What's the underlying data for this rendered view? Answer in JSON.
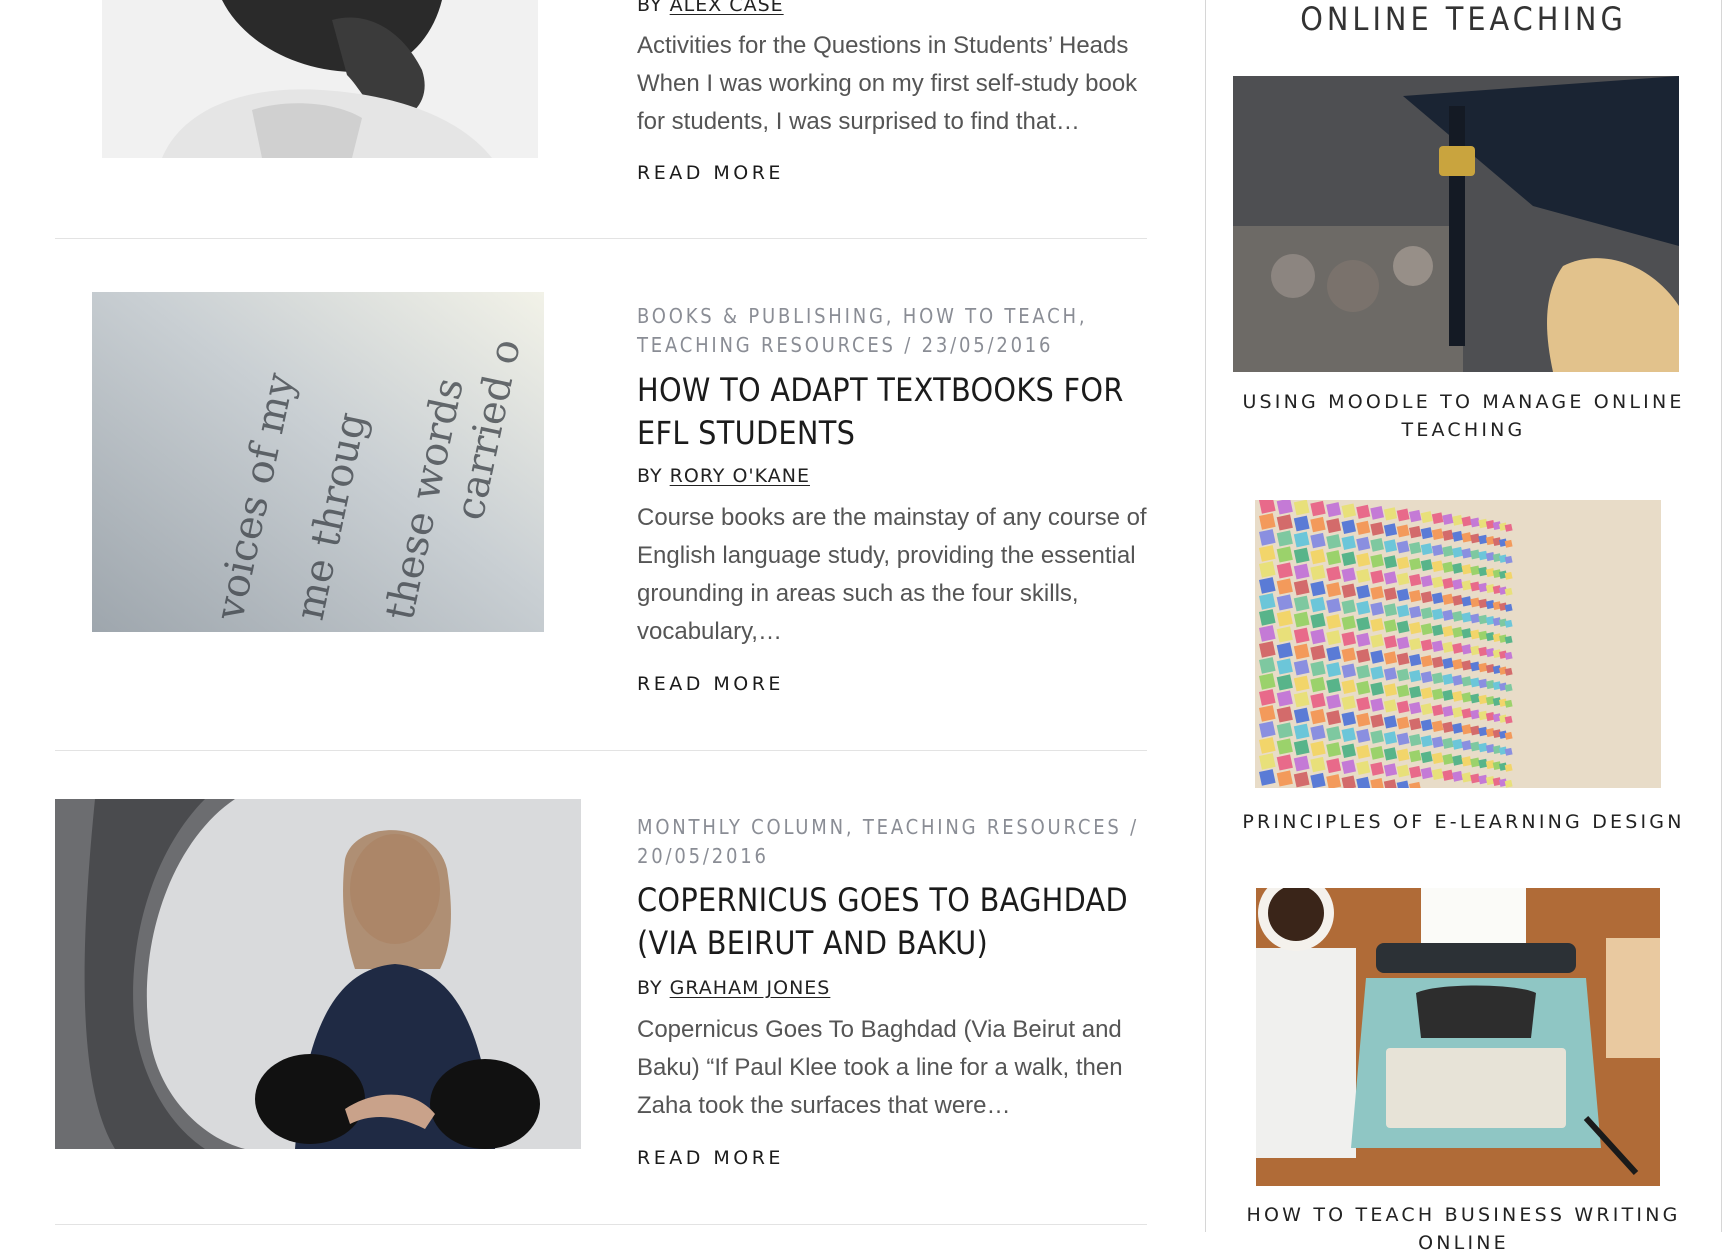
{
  "posts": [
    {
      "byline_prefix": "BY",
      "author": "ALEX CASE",
      "excerpt": "Activities for the Questions in Students’ Heads When I was working on my first self-study book for students, I was surprised to find that…",
      "read_more": "READ MORE"
    },
    {
      "meta": "BOOKS & PUBLISHING, HOW TO TEACH, TEACHING RESOURCES / 23/05/2016",
      "title": "HOW TO ADAPT TEXTBOOKS FOR EFL STUDENTS",
      "byline_prefix": "BY",
      "author": "RORY O'KANE",
      "excerpt": "Course books are the mainstay of any course of English language study, providing the essential grounding in areas such as the four skills, vocabulary,…",
      "read_more": "READ MORE"
    },
    {
      "meta": "MONTHLY COLUMN, TEACHING RESOURCES / 20/05/2016",
      "title": "COPERNICUS GOES TO BAGHDAD (VIA BEIRUT AND BAKU)",
      "byline_prefix": "BY",
      "author": "GRAHAM JONES",
      "excerpt": "Copernicus Goes To Baghdad (Via Beirut and Baku) “If Paul Klee took a line for a walk, then Zaha took the surfaces that were…",
      "read_more": "READ MORE"
    }
  ],
  "sidebar": {
    "heading": "ONLINE TEACHING",
    "items": [
      {
        "caption": "USING MOODLE TO MANAGE ONLINE TEACHING"
      },
      {
        "caption": "PRINCIPLES OF E-LEARNING DESIGN"
      },
      {
        "caption": "HOW TO TEACH BUSINESS WRITING ONLINE"
      }
    ]
  },
  "colors": {
    "meta_gray": "#8a8d95",
    "text_dark": "#1b1b1b",
    "excerpt_gray": "#555555",
    "rule": "#e3e3e3"
  }
}
